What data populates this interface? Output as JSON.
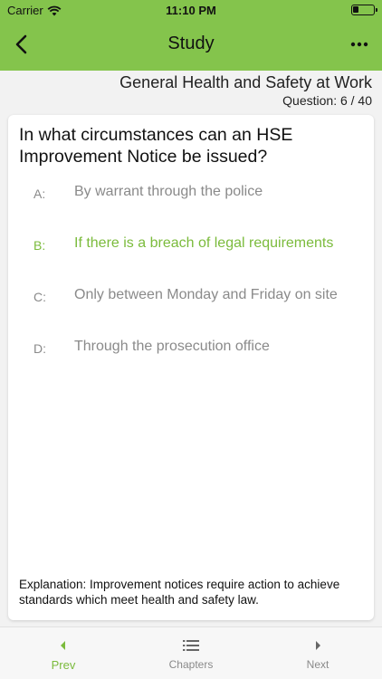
{
  "status": {
    "carrier": "Carrier",
    "time": "11:10 PM",
    "battery_level": 0.3
  },
  "nav": {
    "title": "Study",
    "back_icon": "chevron-left-icon",
    "more_icon": "ellipsis-icon"
  },
  "header": {
    "chapter": "General Health and Safety at Work",
    "question_number": "Question: 6 / 40"
  },
  "question": {
    "text": "In what circumstances can an HSE Improvement Notice be issued?",
    "answers": [
      {
        "letter": "A:",
        "text": "By warrant through the police",
        "correct": false
      },
      {
        "letter": "B:",
        "text": "If there is a breach of legal requirements",
        "correct": true
      },
      {
        "letter": "C:",
        "text": "Only between Monday and Friday on site",
        "correct": false
      },
      {
        "letter": "D:",
        "text": "Through the prosecution office",
        "correct": false
      }
    ],
    "explanation": "Explanation: Improvement notices require action to achieve standards which meet health and safety law."
  },
  "tabs": [
    {
      "label": "Prev",
      "icon": "caret-left-icon",
      "active": true
    },
    {
      "label": "Chapters",
      "icon": "list-icon",
      "active": false
    },
    {
      "label": "Next",
      "icon": "caret-right-icon",
      "active": false
    }
  ],
  "colors": {
    "accent": "#84c44c",
    "correct": "#7bbb3c",
    "muted": "#8a8a8a"
  }
}
